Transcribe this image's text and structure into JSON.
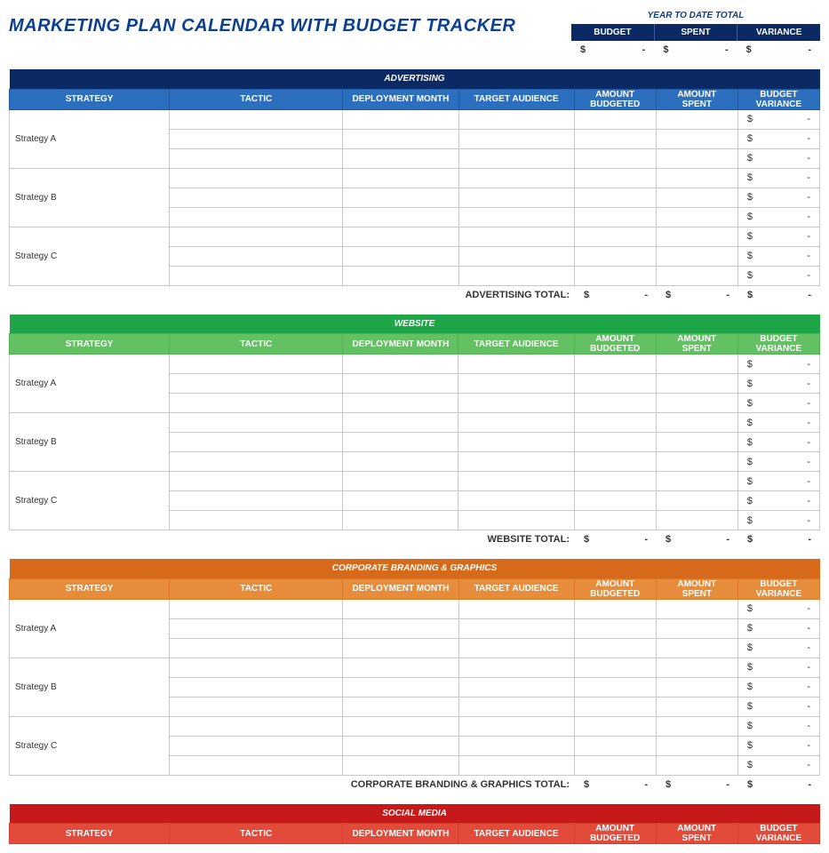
{
  "title": "MARKETING PLAN CALENDAR WITH BUDGET TRACKER",
  "ytd": {
    "title": "YEAR TO DATE TOTAL",
    "headers": [
      "BUDGET",
      "SPENT",
      "VARIANCE"
    ],
    "sym": "$",
    "dash": "-"
  },
  "columns": [
    "STRATEGY",
    "TACTIC",
    "DEPLOYMENT MONTH",
    "TARGET AUDIENCE",
    "AMOUNT BUDGETED",
    "AMOUNT SPENT",
    "BUDGET VARIANCE"
  ],
  "sections": [
    {
      "id": "adv",
      "name": "ADVERTISING",
      "bannerClass": "b-adv",
      "headClass": "h-adv",
      "strategies": [
        "Strategy A",
        "Strategy B",
        "Strategy C"
      ],
      "totalLabel": "ADVERTISING TOTAL:",
      "showRows": true,
      "showTotal": true
    },
    {
      "id": "web",
      "name": "WEBSITE",
      "bannerClass": "b-web",
      "headClass": "h-web",
      "strategies": [
        "Strategy A",
        "Strategy B",
        "Strategy C"
      ],
      "totalLabel": "WEBSITE TOTAL:",
      "showRows": true,
      "showTotal": true
    },
    {
      "id": "corp",
      "name": "CORPORATE BRANDING & GRAPHICS",
      "bannerClass": "b-corp",
      "headClass": "h-corp",
      "strategies": [
        "Strategy A",
        "Strategy B",
        "Strategy C"
      ],
      "totalLabel": "CORPORATE BRANDING & GRAPHICS TOTAL:",
      "showRows": true,
      "showTotal": true
    },
    {
      "id": "soc",
      "name": "SOCIAL MEDIA",
      "bannerClass": "b-soc",
      "headClass": "h-soc",
      "strategies": [],
      "totalLabel": "",
      "showRows": false,
      "showTotal": false
    }
  ],
  "money": {
    "sym": "$",
    "dash": "-"
  }
}
